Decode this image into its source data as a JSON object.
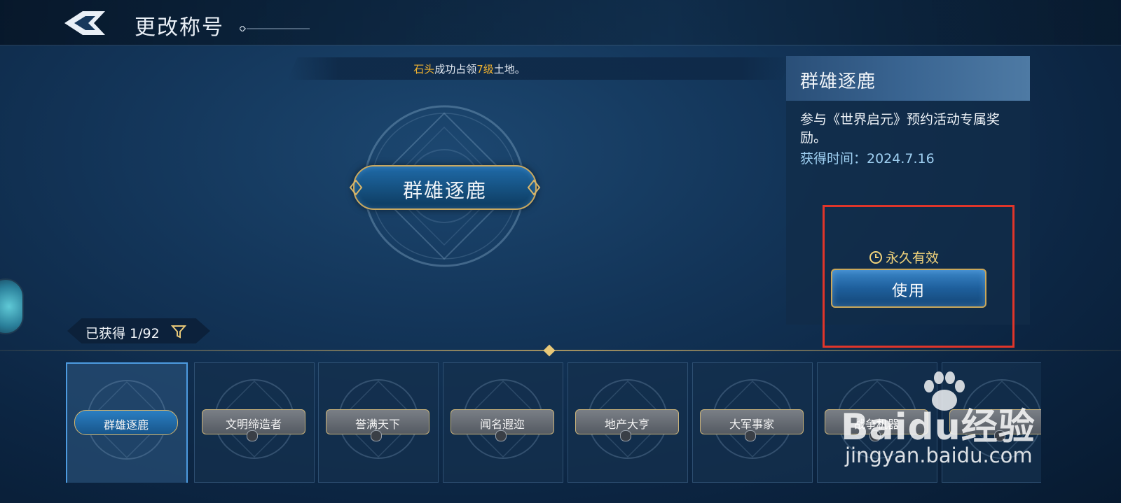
{
  "header": {
    "title": "更改称号"
  },
  "notice": {
    "name": "石头",
    "middle": "成功占领",
    "level": "7级",
    "suffix": "土地。"
  },
  "current_title": "群雄逐鹿",
  "detail": {
    "title": "群雄逐鹿",
    "description": "参与《世界启元》预约活动专属奖励。",
    "acquired": "获得时间：2024.7.16",
    "validity": "永久有效",
    "use_label": "使用"
  },
  "collection": {
    "owned_label": "已获得 1/92"
  },
  "cards": [
    {
      "label": "群雄逐鹿",
      "locked": false,
      "selected": true
    },
    {
      "label": "文明缔造者",
      "locked": true,
      "selected": false
    },
    {
      "label": "誉满天下",
      "locked": true,
      "selected": false
    },
    {
      "label": "闻名遐迩",
      "locked": true,
      "selected": false
    },
    {
      "label": "地产大亨",
      "locked": true,
      "selected": false
    },
    {
      "label": "大军事家",
      "locked": true,
      "selected": false
    },
    {
      "label": "战争机器",
      "locked": true,
      "selected": false
    },
    {
      "label": "",
      "locked": true,
      "selected": false
    }
  ],
  "watermark": {
    "logo": "Baidu经验",
    "url": "jingyan.baidu.com"
  },
  "colors": {
    "accent_gold": "#f0b230",
    "highlight_red": "#e0352a",
    "time_blue": "#9fd0f2"
  }
}
